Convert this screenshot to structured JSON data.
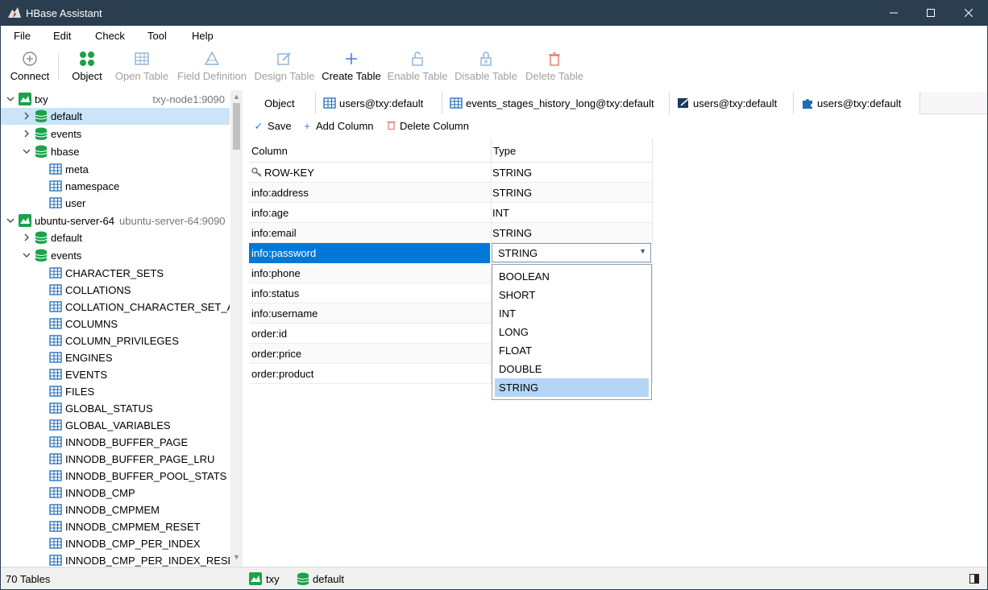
{
  "window": {
    "title": "HBase Assistant"
  },
  "menu": [
    "File",
    "Edit",
    "Check",
    "Tool",
    "Help"
  ],
  "toolbar": {
    "connect": "Connect",
    "object": "Object",
    "open_table": "Open Table",
    "field_definition": "Field Definition",
    "design_table": "Design Table",
    "create_table": "Create Table",
    "enable_table": "Enable Table",
    "disable_table": "Disable Table",
    "delete_table": "Delete Table"
  },
  "tree": {
    "conn1": {
      "name": "txy",
      "host": "txy-node1:9090"
    },
    "conn1_ns": [
      "default",
      "events",
      "hbase"
    ],
    "hbase_tables": [
      "meta",
      "namespace",
      "user"
    ],
    "conn2": {
      "name": "ubuntu-server-64",
      "host": "ubuntu-server-64:9090"
    },
    "conn2_ns": [
      "default",
      "events"
    ],
    "events_tables": [
      "CHARACTER_SETS",
      "COLLATIONS",
      "COLLATION_CHARACTER_SET_APPL",
      "COLUMNS",
      "COLUMN_PRIVILEGES",
      "ENGINES",
      "EVENTS",
      "FILES",
      "GLOBAL_STATUS",
      "GLOBAL_VARIABLES",
      "INNODB_BUFFER_PAGE",
      "INNODB_BUFFER_PAGE_LRU",
      "INNODB_BUFFER_POOL_STATS",
      "INNODB_CMP",
      "INNODB_CMPMEM",
      "INNODB_CMPMEM_RESET",
      "INNODB_CMP_PER_INDEX",
      "INNODB_CMP_PER_INDEX_RESET"
    ]
  },
  "tabs": [
    "Object",
    "users@txy:default",
    "events_stages_history_long@txy:default",
    "users@txy:default",
    "users@txy:default"
  ],
  "subbar": {
    "save": "Save",
    "add_column": "Add Column",
    "delete_column": "Delete Column"
  },
  "grid": {
    "headers": {
      "column": "Column",
      "type": "Type"
    },
    "rows": [
      {
        "column": "ROW-KEY",
        "type": "STRING"
      },
      {
        "column": "info:address",
        "type": "STRING"
      },
      {
        "column": "info:age",
        "type": "INT"
      },
      {
        "column": "info:email",
        "type": "STRING"
      },
      {
        "column": "info:password",
        "type": "STRING"
      },
      {
        "column": "info:phone",
        "type": ""
      },
      {
        "column": "info:status",
        "type": ""
      },
      {
        "column": "info:username",
        "type": ""
      },
      {
        "column": "order:id",
        "type": ""
      },
      {
        "column": "order:price",
        "type": ""
      },
      {
        "column": "order:product",
        "type": ""
      }
    ]
  },
  "dropdown": {
    "options": [
      "BOOLEAN",
      "SHORT",
      "INT",
      "LONG",
      "FLOAT",
      "DOUBLE",
      "STRING"
    ],
    "selected": "STRING"
  },
  "status": {
    "tables": "70 Tables",
    "connection": "txy",
    "namespace": "default"
  },
  "colors": {
    "titlebar": "#2b3e50",
    "selection": "#0078d7",
    "db_green": "#1aa34a",
    "table_blue": "#1e6bb8"
  }
}
